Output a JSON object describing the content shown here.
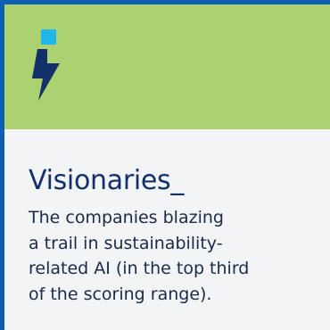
{
  "card": {
    "title": "Visionaries_",
    "description_lines": [
      "The companies blazing",
      "a trail in sustainability-",
      "related AI (in the top third",
      "of the scoring range)."
    ],
    "icon": "lightning-bolt-icon"
  },
  "colors": {
    "border": "#0e5fb4",
    "header_background": "#acd171",
    "body_background": "#f2f4f6",
    "icon_square": "#1fb6e8",
    "icon_bolt": "#13306b",
    "title_text": "#13306b"
  }
}
